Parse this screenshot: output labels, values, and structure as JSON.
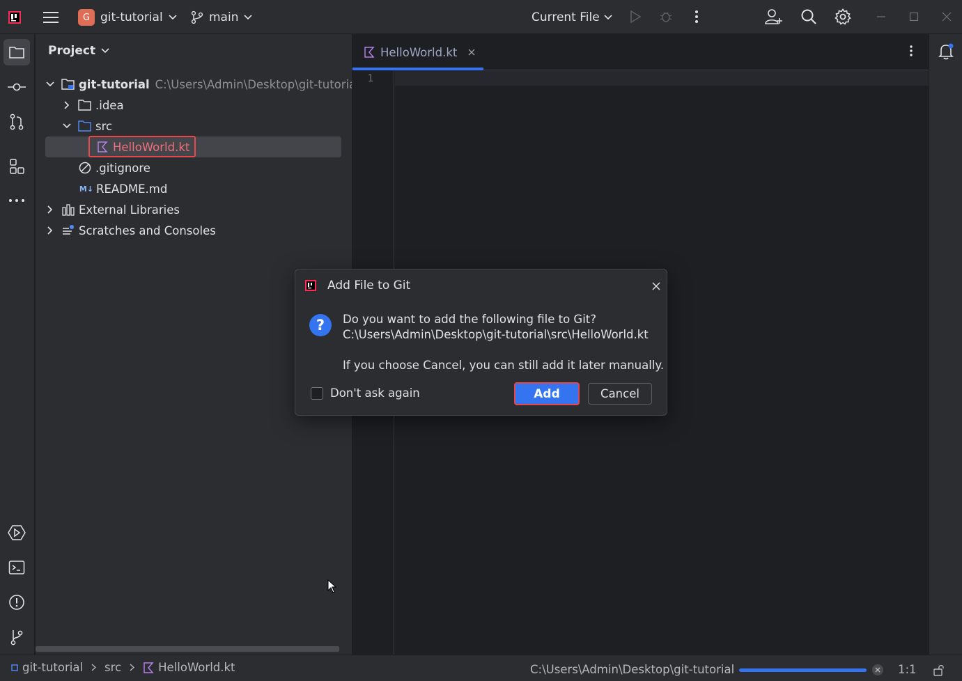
{
  "titlebar": {
    "project_badge": "G",
    "project_name": "git-tutorial",
    "branch": "main",
    "run_config": "Current File"
  },
  "project_panel": {
    "title": "Project",
    "tree": [
      {
        "label": "git-tutorial",
        "path": "C:\\Users\\Admin\\Desktop\\git-tutorial",
        "icon": "module-folder-icon",
        "expanded": true
      },
      {
        "label": ".idea",
        "icon": "folder-icon",
        "expanded": false
      },
      {
        "label": "src",
        "icon": "source-folder-icon",
        "expanded": true
      },
      {
        "label": "HelloWorld.kt",
        "icon": "kotlin-file-icon",
        "selected": true
      },
      {
        "label": ".gitignore",
        "icon": "ignore-file-icon"
      },
      {
        "label": "README.md",
        "icon_text": "M↓",
        "icon": "markdown-icon"
      },
      {
        "label": "External Libraries",
        "icon": "library-icon",
        "expanded": false
      },
      {
        "label": "Scratches and Consoles",
        "icon": "scratches-icon",
        "expanded": false
      }
    ]
  },
  "editor": {
    "tab_label": "HelloWorld.kt",
    "line_numbers": [
      "1"
    ]
  },
  "dialog": {
    "title": "Add File to Git",
    "question": "Do you want to add the following file to Git?",
    "file_path": "C:\\Users\\Admin\\Desktop\\git-tutorial\\src\\HelloWorld.kt",
    "note": "If you choose Cancel, you can still add it later manually.",
    "checkbox_label": "Don't ask again",
    "checkbox_checked": false,
    "add_label": "Add",
    "cancel_label": "Cancel"
  },
  "statusbar": {
    "breadcrumb": [
      "git-tutorial",
      "src",
      "HelloWorld.kt"
    ],
    "progress_text": "C:\\Users\\Admin\\Desktop\\git-tutorial",
    "caret_position": "1:1"
  },
  "colors": {
    "accent": "#3574f0",
    "highlight": "#e5484d",
    "kotlin": "#b37feb"
  }
}
